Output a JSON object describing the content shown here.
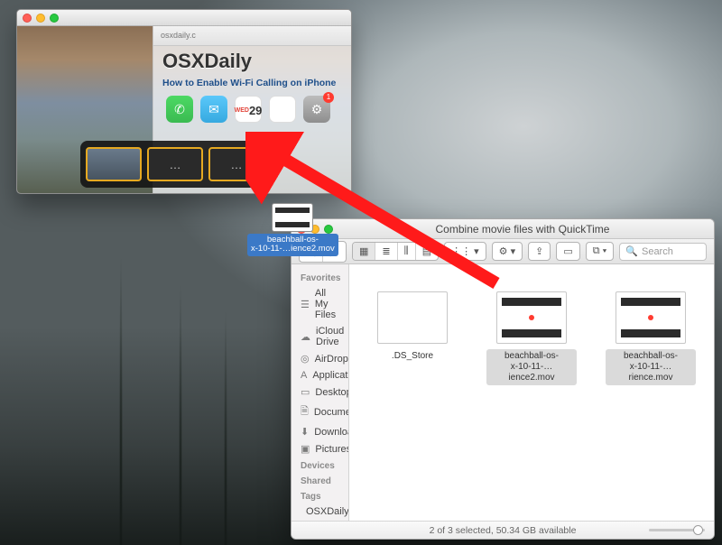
{
  "quicktime": {
    "window_title": "",
    "overlay": {
      "address": "osxdaily.c",
      "logo": "OSXDaily",
      "headline": "How to Enable Wi-Fi Calling on iPhone",
      "calendar_day": "29",
      "badge_count": "1"
    },
    "clips": [
      "thumb",
      "…",
      "…"
    ]
  },
  "drag": {
    "filename": "beachball-os-\nx-10-11-…ience2.mov"
  },
  "finder": {
    "title": "Combine movie files with QuickTime",
    "search_placeholder": "Search",
    "sidebar": {
      "favorites_label": "Favorites",
      "items": [
        {
          "icon": "☰",
          "label": "All My Files"
        },
        {
          "icon": "☁",
          "label": "iCloud Drive"
        },
        {
          "icon": "◎",
          "label": "AirDrop"
        },
        {
          "icon": "A",
          "label": "Applications"
        },
        {
          "icon": "▭",
          "label": "Desktop"
        },
        {
          "icon": "🗎",
          "label": "Documents"
        },
        {
          "icon": "⬇",
          "label": "Downloads"
        },
        {
          "icon": "▣",
          "label": "Pictures"
        }
      ],
      "devices_label": "Devices",
      "shared_label": "Shared",
      "tags_label": "Tags",
      "tag_name": "OSXDaily.com"
    },
    "files": [
      {
        "name": ".DS_Store",
        "type": "generic",
        "selected": false
      },
      {
        "name": "beachball-os-\nx-10-11-…ience2.mov",
        "type": "mov",
        "selected": true
      },
      {
        "name": "beachball-os-\nx-10-11-…rience.mov",
        "type": "mov",
        "selected": true
      }
    ],
    "status": "2 of 3 selected, 50.34 GB available"
  }
}
